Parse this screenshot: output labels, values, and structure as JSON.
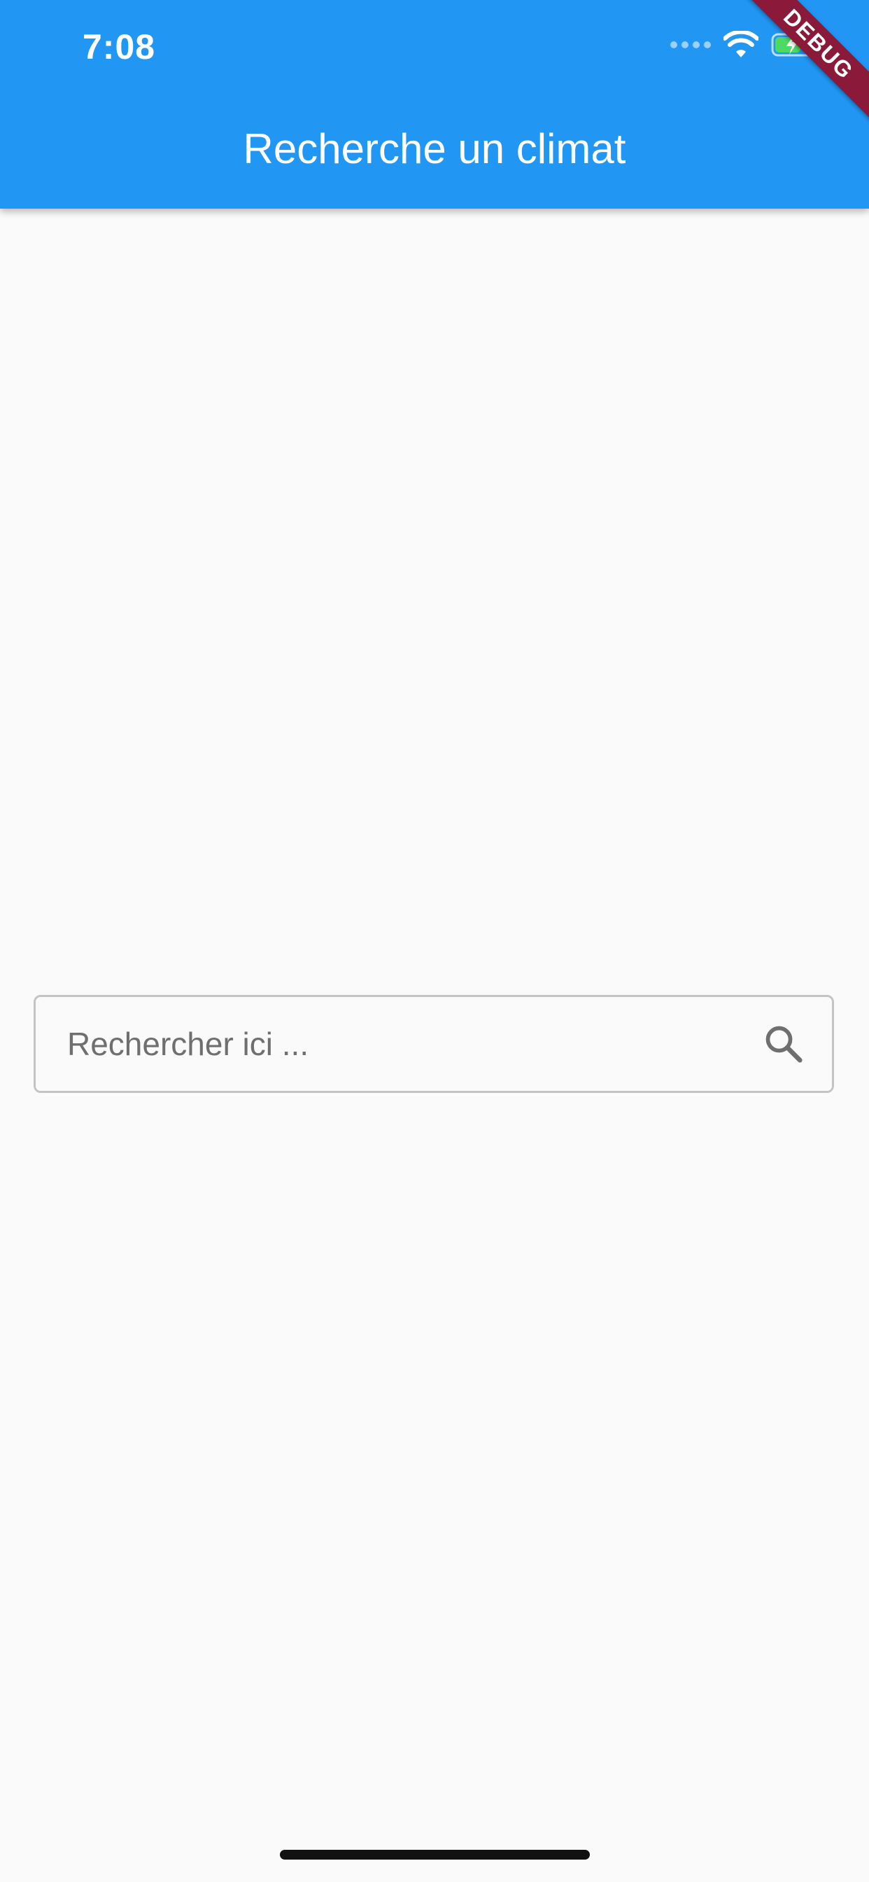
{
  "status_bar": {
    "time": "7:08",
    "wifi_icon": "wifi-icon",
    "battery_icon": "battery-charging-icon",
    "signal_icon": "signal-dots-icon"
  },
  "debug_banner": {
    "label": "DEBUG"
  },
  "app_bar": {
    "title": "Recherche un climat",
    "color": "#2196f3"
  },
  "search": {
    "placeholder": "Rechercher ici ...",
    "value": "",
    "icon": "search-icon"
  },
  "colors": {
    "primary": "#2196f3",
    "background": "#fafafa",
    "debug_ribbon": "#8b1a3a"
  }
}
